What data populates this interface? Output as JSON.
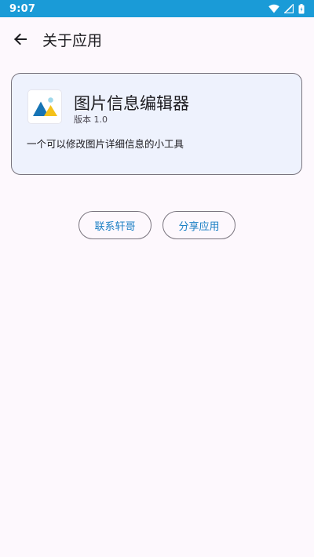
{
  "status_bar": {
    "time": "9:07",
    "icons": [
      "wifi-icon",
      "signal-icon",
      "battery-icon"
    ]
  },
  "app_bar": {
    "back_icon": "arrow-left-icon",
    "title": "关于应用"
  },
  "about_card": {
    "app_name": "图片信息编辑器",
    "version": "版本 1.0",
    "description": "一个可以修改图片详细信息的小工具",
    "logo_icon": "image-editor-logo-icon"
  },
  "actions": {
    "contact_label": "联系轩哥",
    "share_label": "分享应用"
  },
  "colors": {
    "status_bar": "#1a9bd7",
    "background": "#fdf8fd",
    "card_background": "#eef2fd",
    "accent": "#1a7fc4",
    "outline": "#79747e"
  }
}
